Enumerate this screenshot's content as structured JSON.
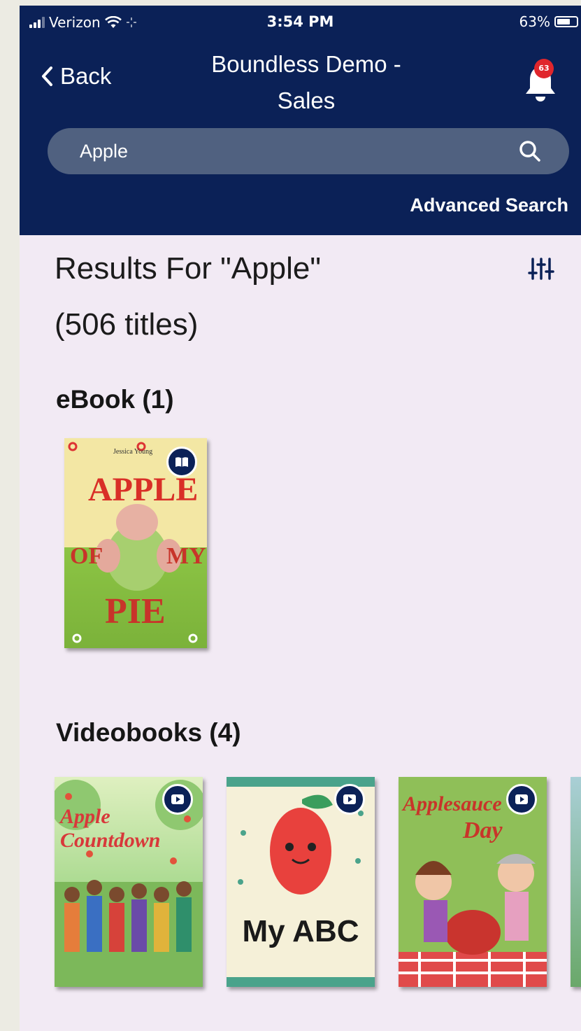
{
  "status_bar": {
    "carrier": "Verizon",
    "time": "3:54 PM",
    "battery": "63%"
  },
  "header": {
    "back_label": "Back",
    "title_line1": "Boundless Demo -",
    "title_line2": "Sales",
    "notification_count": "63"
  },
  "search": {
    "value": "Apple",
    "advanced_label": "Advanced Search"
  },
  "results": {
    "line1": "Results For \"Apple\"",
    "line2": "(506 titles)"
  },
  "sections": [
    {
      "title": "eBook (1)",
      "items": [
        {
          "format_icon": "book-icon",
          "cover_text": [
            "APPLE",
            "OF",
            "MY",
            "PIE"
          ],
          "cover_byline": "Jessica Young"
        }
      ]
    },
    {
      "title": "Videobooks (4)",
      "items": [
        {
          "format_icon": "play-icon",
          "cover_text": [
            "Apple Countdown"
          ]
        },
        {
          "format_icon": "play-icon",
          "cover_text": [
            "My ABC"
          ]
        },
        {
          "format_icon": "play-icon",
          "cover_text": [
            "Applesauce",
            "Day"
          ]
        }
      ]
    }
  ],
  "colors": {
    "header_bg": "#0b2157",
    "search_bg": "#506180",
    "page_bg": "#f2eaf4",
    "badge": "#e0262c"
  }
}
